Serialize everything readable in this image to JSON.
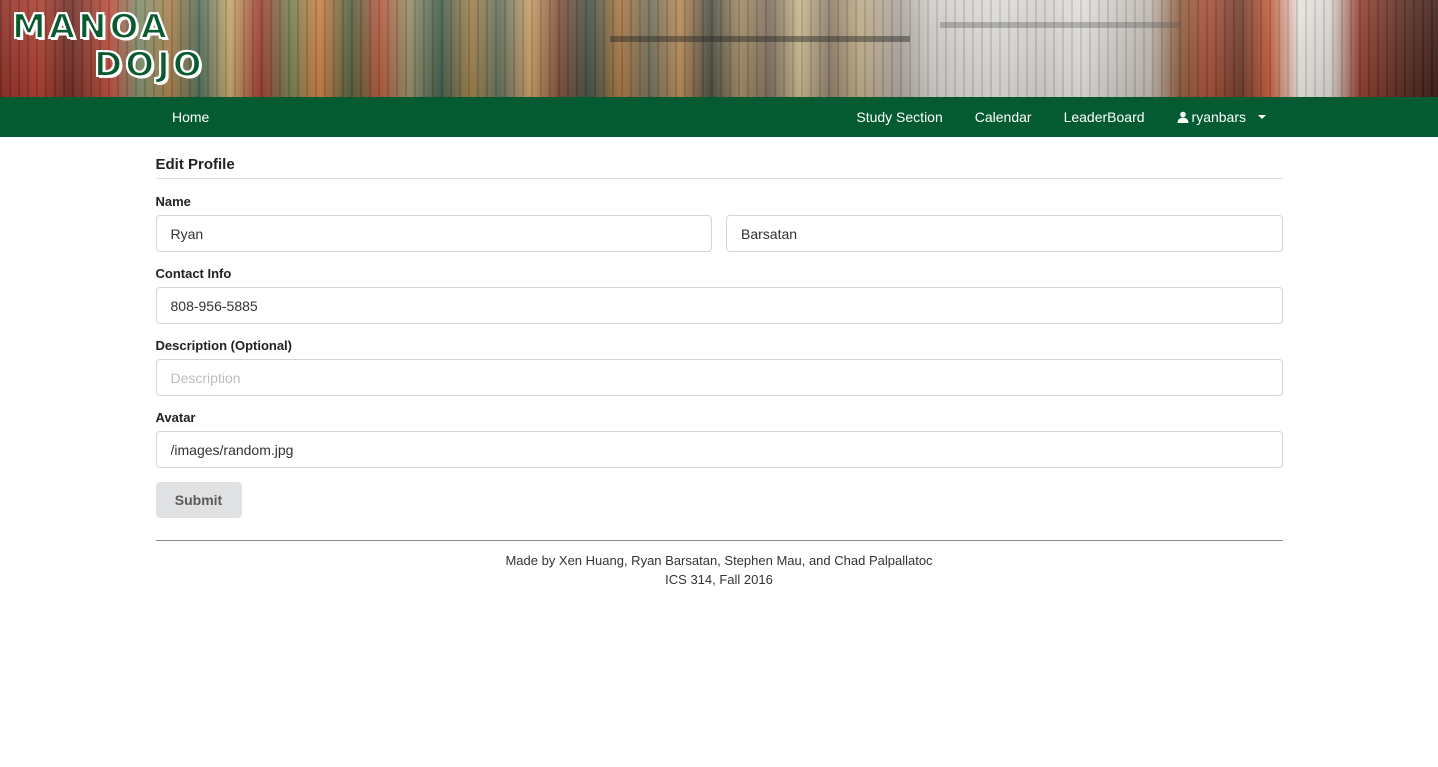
{
  "brand": {
    "logo_line1": "MANOA",
    "logo_line2": "DOJO"
  },
  "nav": {
    "left": [
      {
        "label": "Home"
      }
    ],
    "right": [
      {
        "label": "Study Section"
      },
      {
        "label": "Calendar"
      },
      {
        "label": "LeaderBoard"
      }
    ],
    "user": {
      "icon": "user-icon",
      "username": "ryanbars",
      "dropdown_icon": "caret-down-icon"
    }
  },
  "form": {
    "title": "Edit Profile",
    "name_label": "Name",
    "first_name": "Ryan",
    "last_name": "Barsatan",
    "contact_label": "Contact Info",
    "contact_value": "808-956-5885",
    "description_label": "Description (Optional)",
    "description_value": "",
    "description_placeholder": "Description",
    "avatar_label": "Avatar",
    "avatar_value": "/images/random.jpg",
    "submit_label": "Submit"
  },
  "footer": {
    "line1": "Made by Xen Huang, Ryan Barsatan, Stephen Mau, and Chad Palpallatoc",
    "line2": "ICS 314, Fall 2016"
  },
  "colors": {
    "nav_bg": "#045b32",
    "logo_green": "#0a5a30",
    "button_bg": "#e0e1e2"
  }
}
